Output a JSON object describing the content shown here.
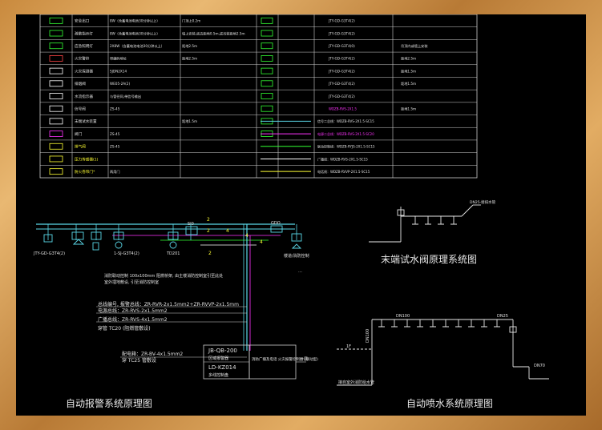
{
  "legend_table": {
    "rows": [
      {
        "name": "安全出口",
        "spec": "8W（含蓄电池电池30分钟以上）",
        "install": "门顶上0.2m",
        "name2": "",
        "code": "JTY-GD-G3T4(2)",
        "note": ""
      },
      {
        "name": "疏散指示灯",
        "spec": "8W（含蓄电池电池30分钟以上）",
        "install": "墙上安装,底边距地0.5m,或吊装距地2.5m",
        "name2": "",
        "code": "JTY-GD-G3T4(2)",
        "note": ""
      },
      {
        "name": "应急照明灯",
        "spec": "2X8W（含蓄电池电池30分钟以上）",
        "install": "距地2.5m",
        "name2": "",
        "code": "JTY-GD-G3T4(0)",
        "note": "吊顶内或墙上安装"
      },
      {
        "name": "火灾警铃",
        "spec": "带编码地址",
        "install": "距地2.5m",
        "name2": "",
        "code": "JTY-GD-G3T4(2)",
        "note": "距地2.5m"
      },
      {
        "name": "火灾探测器",
        "spec": "SJDN2X14",
        "install": "",
        "name2": "",
        "code": "JTY-GD-G3T4(2)",
        "note": "距地1.5m"
      },
      {
        "name": "排烟阀",
        "spec": "WE05-2A(2)",
        "install": "",
        "name2": "",
        "code": "JTY-GD-G3T4(2)",
        "note": "距地1.5m"
      },
      {
        "name": "水流指示器",
        "spec": "与管径同,带信号输出",
        "install": "",
        "name2": "",
        "code": "JTY-GD-G3T4(2)",
        "note": ""
      },
      {
        "name": "信号阀",
        "spec": "ZS-45",
        "install": "",
        "name2": "",
        "code": "",
        "note": "距地1.5m"
      },
      {
        "name": "末端试水装置",
        "spec": "",
        "install": "距地1.5m",
        "name2": "",
        "code": "",
        "note": ""
      },
      {
        "name": "阀门",
        "spec": "ZS-45",
        "install": "",
        "name2": "",
        "code": "",
        "note": ""
      },
      {
        "name": "排气阀",
        "spec": "ZS-45",
        "install": "",
        "name2": "",
        "code": "",
        "note": ""
      },
      {
        "name": "压力传感器(1)",
        "spec": "",
        "install": "",
        "name2": "",
        "code": "",
        "note": ""
      },
      {
        "name": "防火卷帘门*",
        "spec": "两用门",
        "install": "",
        "name2": "",
        "code": "",
        "note": ""
      }
    ],
    "line_legend": [
      {
        "color": "#5ad8e8",
        "text": "信号二总线：WDZB-RVS-2X1.5-SC15"
      },
      {
        "color": "#ff33ff",
        "text": "电源二总线：WDZB-RVS-2X1.5-SC20"
      },
      {
        "color": "#33ff33",
        "text": "联动控制线：WDZB-RYJS-2X1.5-SC15"
      },
      {
        "color": "#ffffff",
        "text": "广播线：WDZB-RVS-2X1.5-SC15"
      },
      {
        "color": "#ffff33",
        "text": "电话线：WDZB-RVVP-2X1.5-SC15"
      }
    ],
    "line_code_pink": "WDZB-RVS-2X1.5"
  },
  "alarm_system": {
    "title": "自动报警系统原理图",
    "device_labels": [
      "JTY-GD-G3T4(2)",
      "1-SJ-G3T4(2)",
      "TD201",
      "SI0",
      "GDO"
    ],
    "notes": [
      "消防联动控制 100x100mm 阻燃桥架, 由主楼消防控制室引至此处",
      "室外埋地敷设, 引至消防控制室"
    ],
    "cable_lines": [
      "总线编号, 报警总线：ZR-RVR-2x1.5mm2+ZR-RVVP-2x1.5mm",
      "电源总线：ZR-RVS-2x1.5mm2",
      "广播总线：ZR-RVS-4x1.5mm2",
      "穿管 TC20 (阻燃管敷设)"
    ],
    "power_line": "配电箱：ZR-BV-4x1.5mm2",
    "power_conduit": "穿 TC25 管敷设",
    "panel_code1": "JB-QB-200",
    "panel_label1": "区域报警器",
    "panel_code2": "LD-KZ014",
    "panel_label2": "多线控制盘",
    "panel_side": "消防广播及电话 火灾报警控制器 (联动型)",
    "room_label": "楼道/消防控制",
    "branch_label": "一层",
    "segment_numbers": [
      "2",
      "2",
      "2",
      "4",
      "4",
      "4"
    ]
  },
  "test_valve": {
    "title": "末端试水阀原理系统图",
    "label": "DN25-接排水管"
  },
  "sprinkler": {
    "title": "自动喷水系统原理图",
    "pipe_main": "DN100",
    "pipe_branch": "DN25",
    "pipe_riser": "DN100",
    "pipe_drain": "DN70",
    "floor_label": "1F",
    "base_label": "接自室外消防给水管"
  }
}
